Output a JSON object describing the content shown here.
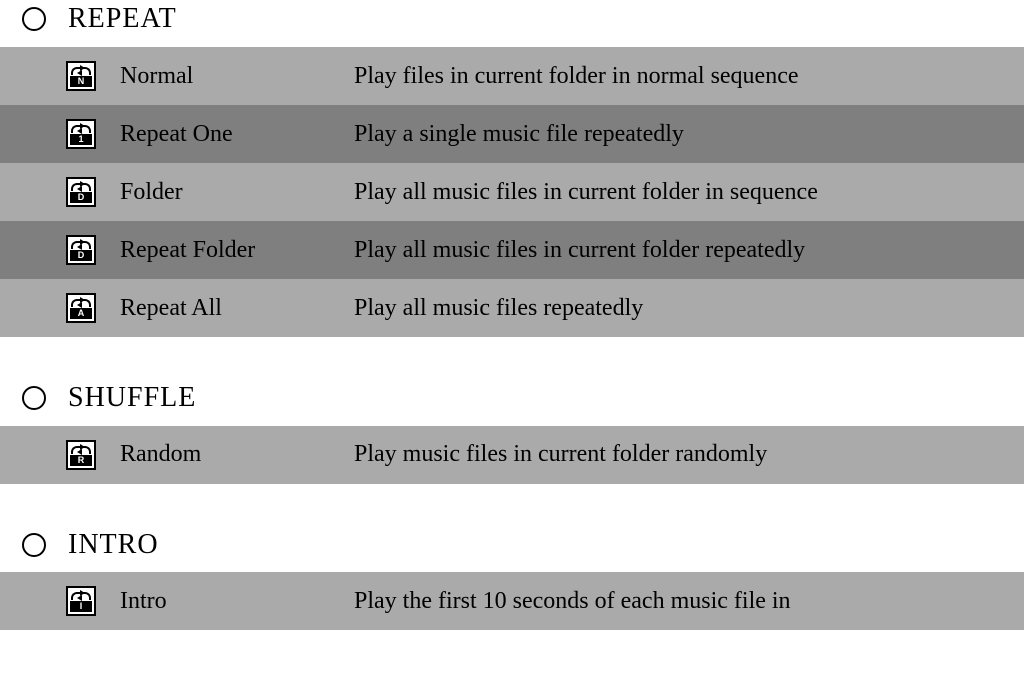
{
  "sections": [
    {
      "id": "repeat",
      "title": "REPEAT",
      "rows": [
        {
          "icon_letter": "N",
          "label": "Normal",
          "desc": "Play files in current folder in normal sequence",
          "shade": "light"
        },
        {
          "icon_letter": "1",
          "label": "Repeat One",
          "desc": "Play a single music file repeatedly",
          "shade": "dark"
        },
        {
          "icon_letter": "D",
          "label": "Folder",
          "desc": "Play all music files in current folder in sequence",
          "shade": "light"
        },
        {
          "icon_letter": "D",
          "label": "Repeat Folder",
          "desc": "Play all music files in current folder repeatedly",
          "shade": "dark"
        },
        {
          "icon_letter": "A",
          "label": "Repeat All",
          "desc": "Play all music files repeatedly",
          "shade": "light"
        }
      ]
    },
    {
      "id": "shuffle",
      "title": "SHUFFLE",
      "rows": [
        {
          "icon_letter": "R",
          "label": "Random",
          "desc": "Play music files in current folder randomly",
          "shade": "light"
        }
      ]
    },
    {
      "id": "intro",
      "title": "INTRO",
      "rows": [
        {
          "icon_letter": "I",
          "label": "Intro",
          "desc": "Play the first 10 seconds of each music file in",
          "shade": "light"
        }
      ]
    }
  ]
}
